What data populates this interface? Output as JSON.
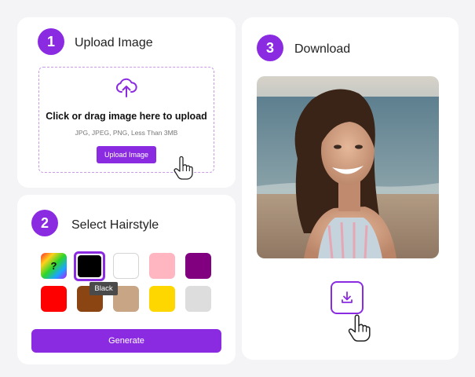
{
  "upload": {
    "step_number": "1",
    "title": "Upload Image",
    "dropzone_text": "Click or drag image here to upload",
    "dropzone_hint": "JPG, JPEG, PNG, Less Than 3MB",
    "button_label": "Upload Image",
    "icon": "cloud-upload-icon"
  },
  "hairstyle": {
    "step_number": "2",
    "title": "Select Hairstyle",
    "swatches": [
      {
        "name": "random",
        "label": "?",
        "color": "rainbow-gradient"
      },
      {
        "name": "black",
        "color": "#000000",
        "selected": true
      },
      {
        "name": "white",
        "color": "#ffffff"
      },
      {
        "name": "pink",
        "color": "#ffb6c1"
      },
      {
        "name": "purple",
        "color": "#800080"
      },
      {
        "name": "red",
        "color": "#ff0000"
      },
      {
        "name": "brown",
        "color": "#8b4513"
      },
      {
        "name": "beige",
        "color": "#c8a584"
      },
      {
        "name": "gold",
        "color": "#ffd700"
      },
      {
        "name": "silver",
        "color": "#dddddd"
      }
    ],
    "tooltip": "Black",
    "generate_label": "Generate"
  },
  "download": {
    "step_number": "3",
    "title": "Download",
    "photo_alt": "portrait",
    "icon": "download-icon"
  },
  "colors": {
    "accent": "#8a2be2",
    "background": "#f4f4f6"
  }
}
